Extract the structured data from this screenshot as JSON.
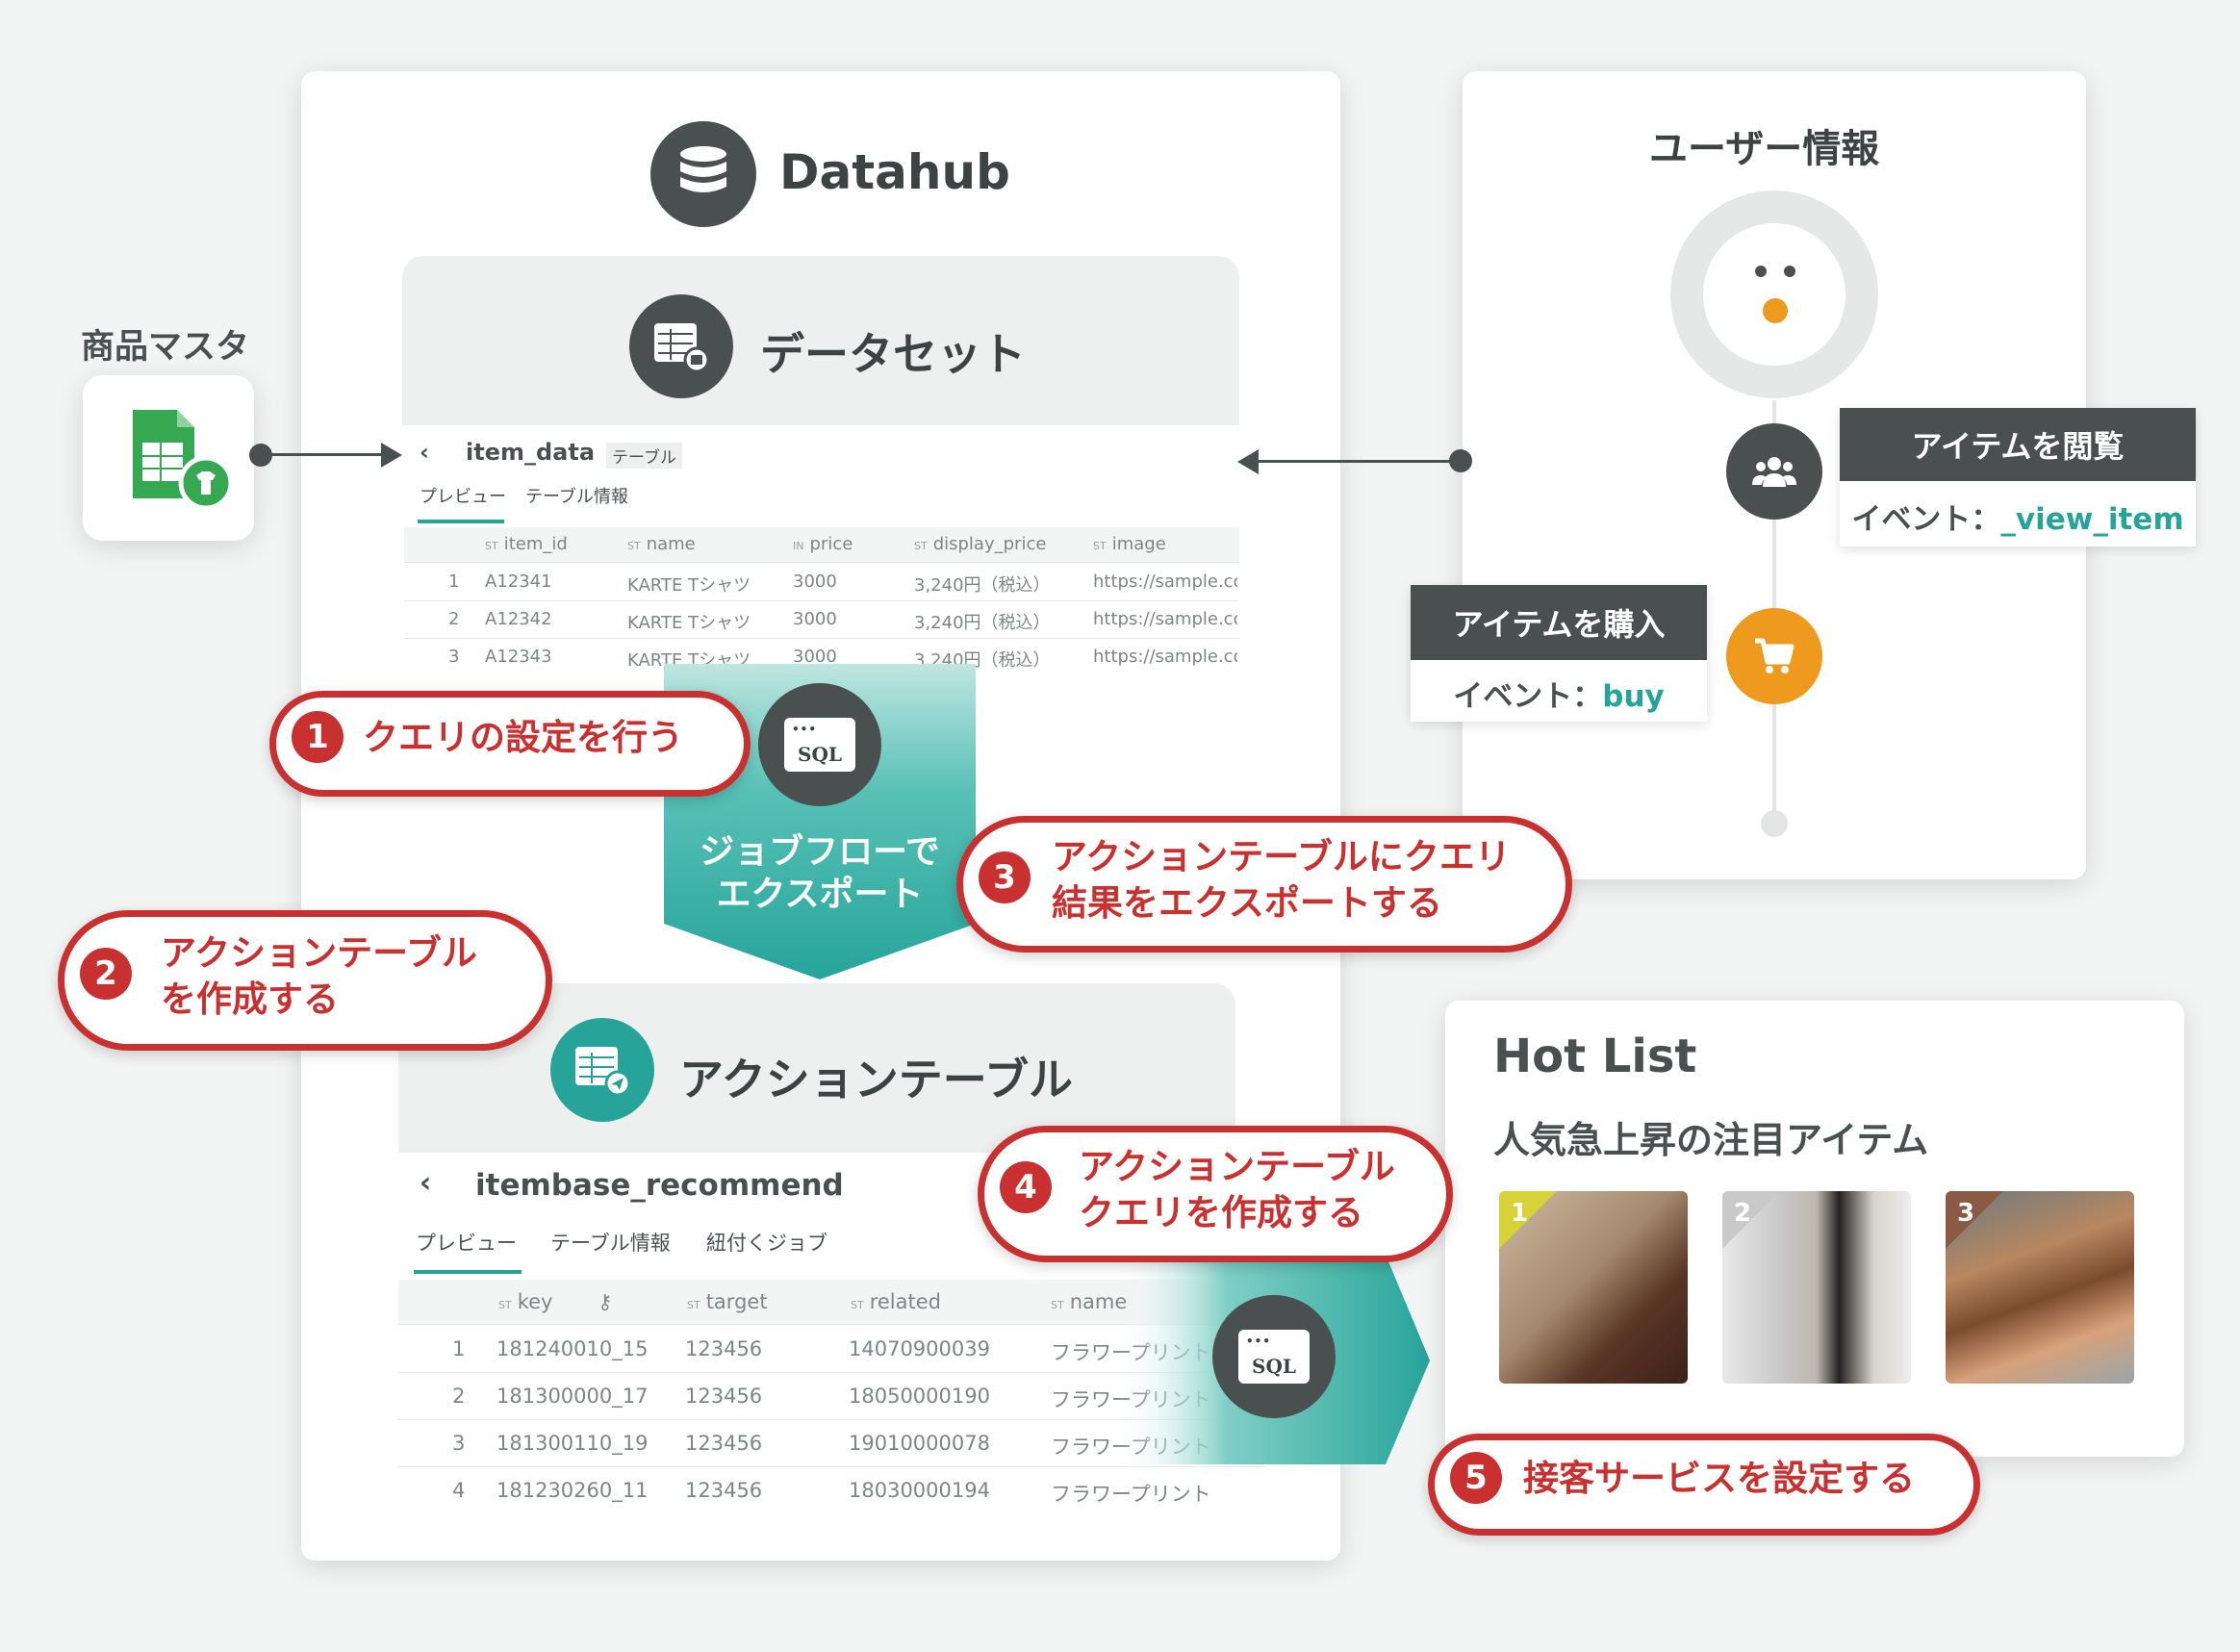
{
  "datahub": {
    "title": "Datahub"
  },
  "dataset": {
    "title": "データセット",
    "table_name": "item_data",
    "table_tag": "テーブル",
    "tabs": [
      "プレビュー",
      "テーブル情報"
    ],
    "columns": [
      {
        "type": "ST",
        "name": "item_id"
      },
      {
        "type": "ST",
        "name": "name"
      },
      {
        "type": "IN",
        "name": "price"
      },
      {
        "type": "ST",
        "name": "display_price"
      },
      {
        "type": "ST",
        "name": "image"
      }
    ],
    "rows": [
      [
        "1",
        "A12341",
        "KARTE Tシャツ",
        "3000",
        "3,240円（税込）",
        "https://sample.co"
      ],
      [
        "2",
        "A12342",
        "KARTE Tシャツ",
        "3000",
        "3,240円（税込）",
        "https://sample.co"
      ],
      [
        "3",
        "A12343",
        "KARTE Tシャツ",
        "3000",
        "3,240円（税込）",
        "https://sample.co"
      ]
    ]
  },
  "source": {
    "label": "商品マスタ"
  },
  "jobflow": {
    "line1": "ジョブフローで",
    "line2": "エクスポート"
  },
  "sql_label": "SQL",
  "action_table": {
    "title": "アクションテーブル",
    "table_name": "itembase_recommend",
    "tabs": [
      "プレビュー",
      "テーブル情報",
      "紐付くジョブ"
    ],
    "columns": [
      {
        "type": "ST",
        "name": "key"
      },
      {
        "type": "ST",
        "name": "target"
      },
      {
        "type": "ST",
        "name": "related"
      },
      {
        "type": "ST",
        "name": "name"
      }
    ],
    "rows": [
      [
        "1",
        "181240010_15",
        "123456",
        "14070900039",
        "フラワープリント"
      ],
      [
        "2",
        "181300000_17",
        "123456",
        "18050000190",
        "フラワープリント"
      ],
      [
        "3",
        "181300110_19",
        "123456",
        "19010000078",
        "フラワープリント"
      ],
      [
        "4",
        "181230260_11",
        "123456",
        "18030000194",
        "フラワープリント"
      ]
    ]
  },
  "steps": [
    {
      "num": "1",
      "line1": "クエリの設定を行う",
      "line2": ""
    },
    {
      "num": "2",
      "line1": "アクションテーブル",
      "line2": "を作成する"
    },
    {
      "num": "3",
      "line1": "アクションテーブルにクエリ",
      "line2": "結果をエクスポートする"
    },
    {
      "num": "4",
      "line1": "アクションテーブル",
      "line2": "クエリを作成する"
    },
    {
      "num": "5",
      "line1": "接客サービスを設定する",
      "line2": ""
    }
  ],
  "user_info": {
    "title": "ユーザー情報",
    "events": [
      {
        "head": "アイテムを閲覧",
        "prefix": "イベント：",
        "event": "_view_item"
      },
      {
        "head": "アイテムを購入",
        "prefix": "イベント：",
        "event": "buy"
      }
    ]
  },
  "hotlist": {
    "title": "Hot List",
    "subtitle": "人気急上昇の注目アイテム",
    "ranks": [
      "1",
      "2",
      "3"
    ]
  },
  "colors": {
    "accent_red": "#c8312f",
    "teal": "#27a49a",
    "dark": "#4a5050",
    "orange": "#ee9a1f",
    "green": "#36a852"
  }
}
